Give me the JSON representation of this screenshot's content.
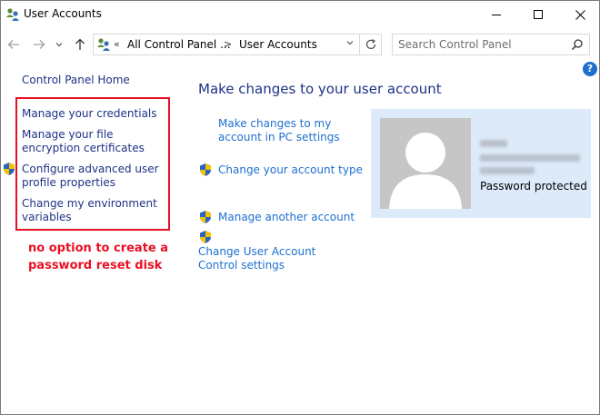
{
  "window": {
    "title": "User Accounts"
  },
  "address_bar": {
    "overflow_chevron": "«",
    "crumb_root": "All Control Panel ...",
    "crumb_separator": ">",
    "crumb_current": "User Accounts"
  },
  "search": {
    "placeholder": "Search Control Panel"
  },
  "sidebar": {
    "home_label": "Control Panel Home",
    "items": [
      {
        "label": "Manage your credentials",
        "shield": false
      },
      {
        "label": "Manage your file encryption certificates",
        "shield": false
      },
      {
        "label": "Configure advanced user profile properties",
        "shield": true
      },
      {
        "label": "Change my environment variables",
        "shield": false
      }
    ]
  },
  "annotation": {
    "text": "no option to create a password reset disk",
    "color": "#e81123"
  },
  "main": {
    "title": "Make changes to your user account",
    "links": [
      {
        "label": "Make changes to my account in PC settings",
        "shield": false
      },
      {
        "label": "Change your account type",
        "shield": true
      },
      {
        "label": "Manage another account",
        "shield": true
      },
      {
        "label": "Change User Account Control settings",
        "shield": true
      }
    ]
  },
  "user_card": {
    "status": "Password protected"
  },
  "colors": {
    "link": "#1e6fd0",
    "nav_link": "#1e3287",
    "card_bg": "#dceaf9",
    "highlight_box": "#e81123"
  },
  "icons": {
    "app": "user-accounts-icon",
    "uac": "uac-shield-icon",
    "help": "help-icon"
  }
}
